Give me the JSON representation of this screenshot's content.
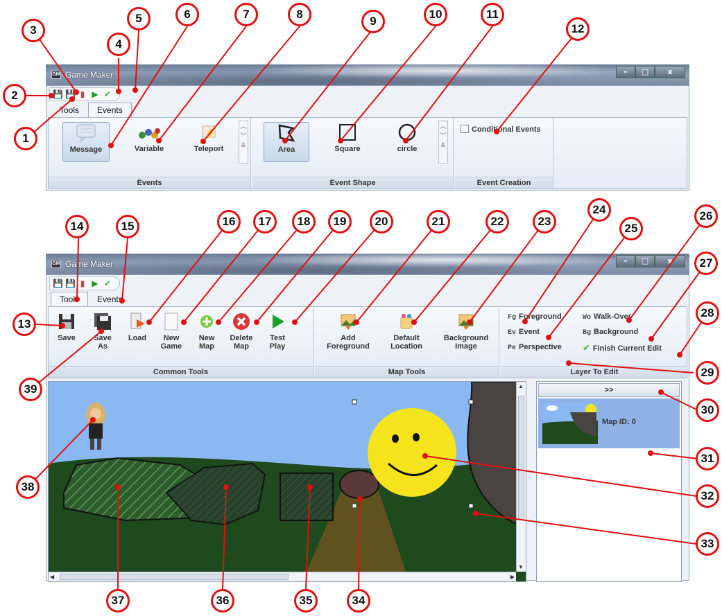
{
  "window_title": "Game Maker",
  "tabs": {
    "tools": "Tools",
    "events": "Events"
  },
  "window_controls": {
    "minimize": "–",
    "maximize": "□",
    "close": "x"
  },
  "events_ribbon": {
    "event_buttons": [
      "Message",
      "Variable",
      "Teleport"
    ],
    "shape_buttons": [
      "Area",
      "Square",
      "circle"
    ],
    "conditional_label": "Conditional Events",
    "groups": [
      "Events",
      "Event Shape",
      "Event Creation"
    ]
  },
  "tools_ribbon": {
    "common_buttons": [
      {
        "line1": "Save",
        "line2": ""
      },
      {
        "line1": "Save",
        "line2": "As"
      },
      {
        "line1": "Load",
        "line2": ""
      },
      {
        "line1": "New",
        "line2": "Game"
      },
      {
        "line1": "New",
        "line2": "Map"
      },
      {
        "line1": "Delete",
        "line2": "Map"
      },
      {
        "line1": "Test",
        "line2": "Play"
      }
    ],
    "map_buttons": [
      {
        "line1": "Add",
        "line2": "Foreground"
      },
      {
        "line1": "Default",
        "line2": "Location"
      },
      {
        "line1": "Background",
        "line2": "Image"
      }
    ],
    "layers": [
      {
        "abbr": "Fg",
        "label": "Foreground"
      },
      {
        "abbr": "Ev",
        "label": "Event"
      },
      {
        "abbr": "Pe",
        "label": "Perspective"
      },
      {
        "abbr": "Wo",
        "label": "Walk-Over"
      },
      {
        "abbr": "Bg",
        "label": "Background"
      },
      {
        "abbr": "✔",
        "label": "Finish Current Edit"
      }
    ],
    "groups": [
      "Common Tools",
      "Map Tools",
      "Layer To Edit"
    ]
  },
  "side_panel": {
    "expand_label": ">>",
    "map_id_label": "Map ID: 0"
  },
  "callouts": [
    "1",
    "2",
    "3",
    "4",
    "5",
    "6",
    "7",
    "8",
    "9",
    "10",
    "11",
    "12",
    "13",
    "14",
    "15",
    "16",
    "17",
    "18",
    "19",
    "20",
    "21",
    "22",
    "23",
    "24",
    "25",
    "26",
    "27",
    "28",
    "29",
    "30",
    "31",
    "32",
    "33",
    "34",
    "35",
    "36",
    "37",
    "38",
    "39"
  ],
  "colors": {
    "callout_red": "#e01010",
    "sky": "#8ab8f2",
    "grass": "#1f4a1e",
    "smiley": "#f5e31c",
    "path": "#6b5420",
    "tree": "#4a4440"
  }
}
